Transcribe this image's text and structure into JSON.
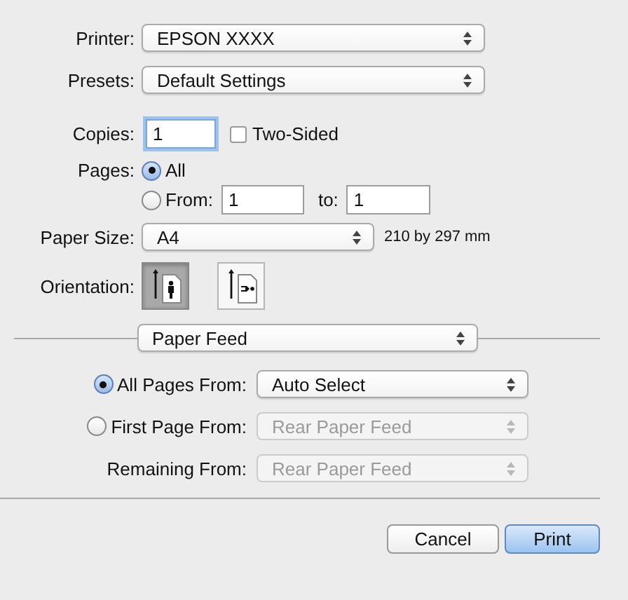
{
  "printer": {
    "label": "Printer:",
    "value": "EPSON XXXX"
  },
  "presets": {
    "label": "Presets:",
    "value": "Default Settings"
  },
  "copies": {
    "label": "Copies:",
    "value": "1"
  },
  "two_sided": {
    "label": "Two-Sided",
    "checked": false
  },
  "pages": {
    "label": "Pages:",
    "options": [
      {
        "label": "All",
        "selected": true
      },
      {
        "label": "From:",
        "selected": false
      }
    ],
    "from": "1",
    "to_label": "to:",
    "to": "1"
  },
  "paper_size": {
    "label": "Paper Size:",
    "value": "A4",
    "dimensions": "210 by 297 mm"
  },
  "orientation": {
    "label": "Orientation:",
    "options": [
      {
        "kind": "portrait",
        "selected": true
      },
      {
        "kind": "landscape",
        "selected": false
      }
    ]
  },
  "panel_menu": {
    "value": "Paper Feed"
  },
  "paper_feed": [
    {
      "kind": "radio",
      "label": "All Pages From:",
      "value": "Auto Select",
      "selected": true,
      "disabled": false
    },
    {
      "kind": "radio",
      "label": "First Page From:",
      "value": "Rear Paper Feed",
      "selected": false,
      "disabled": true
    },
    {
      "kind": "plain",
      "label": "Remaining From:",
      "value": "Rear Paper Feed",
      "disabled": true
    }
  ],
  "buttons": [
    {
      "label": "Cancel",
      "default": false
    },
    {
      "label": "Print",
      "default": true
    }
  ]
}
